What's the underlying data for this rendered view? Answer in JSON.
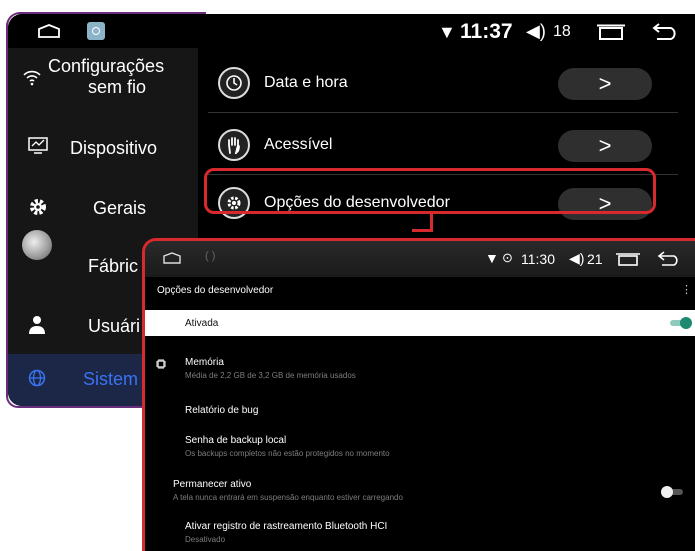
{
  "back_panel": {
    "status_bar": {
      "time": "11:37",
      "volume_level": "18",
      "icons": [
        "home-icon",
        "app-icon",
        "wifi-icon",
        "volume-icon",
        "recent-apps-icon",
        "back-icon"
      ]
    },
    "sidebar": {
      "items": [
        {
          "label_line1": "Configurações",
          "label_line2": "sem fio",
          "icon": "wifi-icon"
        },
        {
          "label": "Dispositivo",
          "icon": "device-monitor-icon"
        },
        {
          "label": "Gerais",
          "icon": "gear-icon"
        },
        {
          "label": "Fábric",
          "icon": "factory-icon"
        },
        {
          "label": "Usuári",
          "icon": "user-icon"
        },
        {
          "label": "Sistem",
          "icon": "globe-icon",
          "active": true
        }
      ]
    },
    "rows": [
      {
        "label": "Data e hora",
        "icon": "clock-icon",
        "button": ">"
      },
      {
        "label": "Acessível",
        "icon": "hand-icon",
        "button": ">"
      },
      {
        "label": "Opções do desenvolvedor",
        "icon": "gear-icon",
        "button": ">",
        "highlighted": true
      }
    ]
  },
  "front_panel": {
    "status_bar": {
      "dots": "( )",
      "time": "11:30",
      "volume_level": "21"
    },
    "title": "Opções do desenvolvedor",
    "more_menu": "⋮",
    "master_toggle": {
      "label": "Ativada",
      "on": true
    },
    "items": [
      {
        "title": "Memória",
        "summary": "Média de 2,2 GB de 3,2 GB de memória usados",
        "icon": "chip-icon"
      },
      {
        "title": "Relatório de bug",
        "summary": ""
      },
      {
        "title": "Senha de backup local",
        "summary": "Os backups completos não estão protegidos no momento"
      },
      {
        "title": "Permanecer ativo",
        "summary": "A tela nunca entrará em suspensão enquanto estiver carregando",
        "toggle_on": false
      },
      {
        "title": "Ativar registro de rastreamento Bluetooth HCI",
        "summary": "Desativado"
      }
    ]
  },
  "colors": {
    "highlight": "#d7292e",
    "frame": "#6b2c7d",
    "active_text": "#3a73f2",
    "toggle_on": "#1e8a70"
  }
}
